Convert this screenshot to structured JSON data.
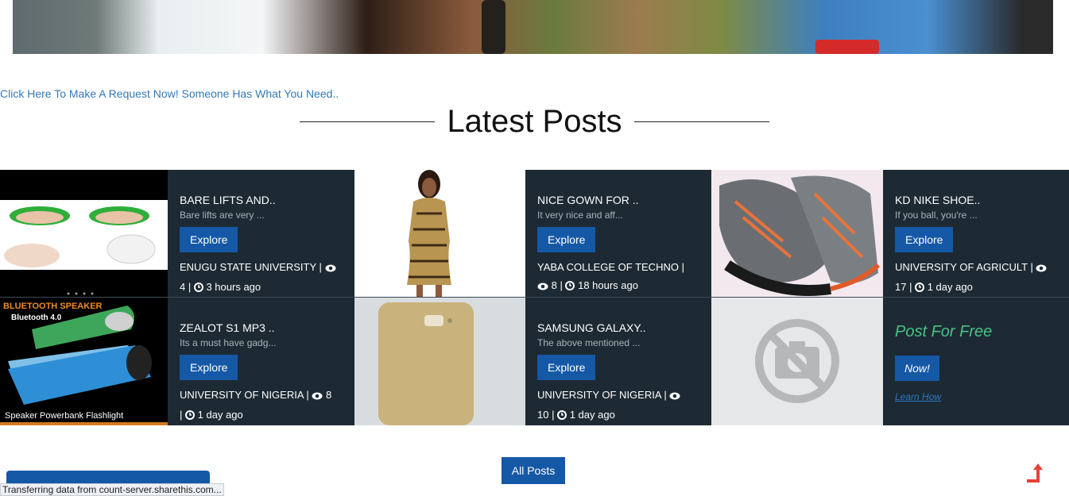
{
  "request_link": "Click Here To Make A Request Now! Someone Has What You Need..",
  "section_title": "Latest Posts",
  "posts": [
    {
      "title": "BARE LIFTS AND..",
      "desc": "Bare lifts are very ...",
      "button": "Explore",
      "school": "ENUGU STATE UNIVERSITY |",
      "views": "4",
      "time": "3 hours ago"
    },
    {
      "title": "NICE GOWN FOR ..",
      "desc": "It very nice and aff...",
      "button": "Explore",
      "school": "YABA COLLEGE OF TECHNO |",
      "views": "8",
      "time": "18 hours ago"
    },
    {
      "title": "KD NIKE SHOE..",
      "desc": "If you ball, you're ...",
      "button": "Explore",
      "school": "UNIVERSITY OF AGRICULT |",
      "views": "17",
      "time": "1 day ago"
    },
    {
      "title": "ZEALOT S1 MP3 ..",
      "desc": "Its a must have gadg...",
      "button": "Explore",
      "school": "UNIVERSITY OF NIGERIA |",
      "views": "8",
      "time": "1 day ago"
    },
    {
      "title": "SAMSUNG GALAXY..",
      "desc": "The above mentioned ...",
      "button": "Explore",
      "school": "UNIVERSITY OF NIGERIA |",
      "views": "10",
      "time": "1 day ago"
    }
  ],
  "thumb_text": {
    "speaker_title": "BLUETOOTH SPEAKER",
    "bluetooth": "Bluetooth 4.0",
    "speaker_caption": "Speaker  Powerbank  Flashlight"
  },
  "post_free": {
    "title": "Post For Free",
    "button": "Now!",
    "link": "Learn How"
  },
  "all_posts": "All Posts",
  "status_bar": "Transferring data from count-server.sharethis.com...",
  "colors": {
    "accent": "#1558a6",
    "green": "#4ac186",
    "dark": "#1d2a33",
    "link": "#337ab7"
  }
}
